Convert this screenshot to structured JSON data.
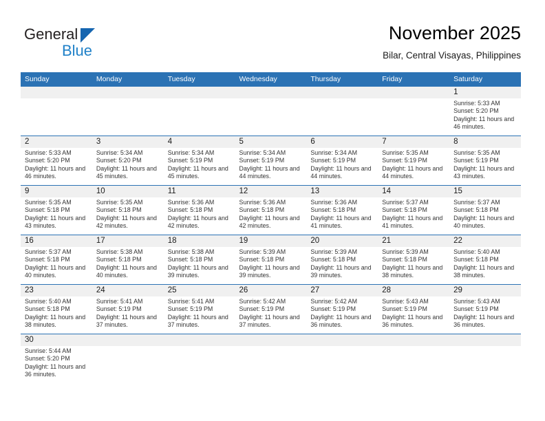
{
  "brand": {
    "name_part1": "General",
    "name_part2": "Blue",
    "colors": {
      "dark": "#231f20",
      "blue": "#2081c8",
      "triangle": "#1565b0"
    }
  },
  "header": {
    "title": "November 2025",
    "subtitle": "Bilar, Central Visayas, Philippines"
  },
  "theme": {
    "header_bg": "#2b72b4",
    "daynum_bg": "#f0f0f0",
    "row_divider": "#2b72b4"
  },
  "weekdays": [
    "Sunday",
    "Monday",
    "Tuesday",
    "Wednesday",
    "Thursday",
    "Friday",
    "Saturday"
  ],
  "labels": {
    "sunrise": "Sunrise:",
    "sunset": "Sunset:",
    "daylight": "Daylight:"
  },
  "weeks": [
    [
      {
        "empty": true
      },
      {
        "empty": true
      },
      {
        "empty": true
      },
      {
        "empty": true
      },
      {
        "empty": true
      },
      {
        "empty": true
      },
      {
        "day": "1",
        "sunrise": "Sunrise: 5:33 AM",
        "sunset": "Sunset: 5:20 PM",
        "daylight": "Daylight: 11 hours and 46 minutes."
      }
    ],
    [
      {
        "day": "2",
        "sunrise": "Sunrise: 5:33 AM",
        "sunset": "Sunset: 5:20 PM",
        "daylight": "Daylight: 11 hours and 46 minutes."
      },
      {
        "day": "3",
        "sunrise": "Sunrise: 5:34 AM",
        "sunset": "Sunset: 5:20 PM",
        "daylight": "Daylight: 11 hours and 45 minutes."
      },
      {
        "day": "4",
        "sunrise": "Sunrise: 5:34 AM",
        "sunset": "Sunset: 5:19 PM",
        "daylight": "Daylight: 11 hours and 45 minutes."
      },
      {
        "day": "5",
        "sunrise": "Sunrise: 5:34 AM",
        "sunset": "Sunset: 5:19 PM",
        "daylight": "Daylight: 11 hours and 44 minutes."
      },
      {
        "day": "6",
        "sunrise": "Sunrise: 5:34 AM",
        "sunset": "Sunset: 5:19 PM",
        "daylight": "Daylight: 11 hours and 44 minutes."
      },
      {
        "day": "7",
        "sunrise": "Sunrise: 5:35 AM",
        "sunset": "Sunset: 5:19 PM",
        "daylight": "Daylight: 11 hours and 44 minutes."
      },
      {
        "day": "8",
        "sunrise": "Sunrise: 5:35 AM",
        "sunset": "Sunset: 5:19 PM",
        "daylight": "Daylight: 11 hours and 43 minutes."
      }
    ],
    [
      {
        "day": "9",
        "sunrise": "Sunrise: 5:35 AM",
        "sunset": "Sunset: 5:18 PM",
        "daylight": "Daylight: 11 hours and 43 minutes."
      },
      {
        "day": "10",
        "sunrise": "Sunrise: 5:35 AM",
        "sunset": "Sunset: 5:18 PM",
        "daylight": "Daylight: 11 hours and 42 minutes."
      },
      {
        "day": "11",
        "sunrise": "Sunrise: 5:36 AM",
        "sunset": "Sunset: 5:18 PM",
        "daylight": "Daylight: 11 hours and 42 minutes."
      },
      {
        "day": "12",
        "sunrise": "Sunrise: 5:36 AM",
        "sunset": "Sunset: 5:18 PM",
        "daylight": "Daylight: 11 hours and 42 minutes."
      },
      {
        "day": "13",
        "sunrise": "Sunrise: 5:36 AM",
        "sunset": "Sunset: 5:18 PM",
        "daylight": "Daylight: 11 hours and 41 minutes."
      },
      {
        "day": "14",
        "sunrise": "Sunrise: 5:37 AM",
        "sunset": "Sunset: 5:18 PM",
        "daylight": "Daylight: 11 hours and 41 minutes."
      },
      {
        "day": "15",
        "sunrise": "Sunrise: 5:37 AM",
        "sunset": "Sunset: 5:18 PM",
        "daylight": "Daylight: 11 hours and 40 minutes."
      }
    ],
    [
      {
        "day": "16",
        "sunrise": "Sunrise: 5:37 AM",
        "sunset": "Sunset: 5:18 PM",
        "daylight": "Daylight: 11 hours and 40 minutes."
      },
      {
        "day": "17",
        "sunrise": "Sunrise: 5:38 AM",
        "sunset": "Sunset: 5:18 PM",
        "daylight": "Daylight: 11 hours and 40 minutes."
      },
      {
        "day": "18",
        "sunrise": "Sunrise: 5:38 AM",
        "sunset": "Sunset: 5:18 PM",
        "daylight": "Daylight: 11 hours and 39 minutes."
      },
      {
        "day": "19",
        "sunrise": "Sunrise: 5:39 AM",
        "sunset": "Sunset: 5:18 PM",
        "daylight": "Daylight: 11 hours and 39 minutes."
      },
      {
        "day": "20",
        "sunrise": "Sunrise: 5:39 AM",
        "sunset": "Sunset: 5:18 PM",
        "daylight": "Daylight: 11 hours and 39 minutes."
      },
      {
        "day": "21",
        "sunrise": "Sunrise: 5:39 AM",
        "sunset": "Sunset: 5:18 PM",
        "daylight": "Daylight: 11 hours and 38 minutes."
      },
      {
        "day": "22",
        "sunrise": "Sunrise: 5:40 AM",
        "sunset": "Sunset: 5:18 PM",
        "daylight": "Daylight: 11 hours and 38 minutes."
      }
    ],
    [
      {
        "day": "23",
        "sunrise": "Sunrise: 5:40 AM",
        "sunset": "Sunset: 5:18 PM",
        "daylight": "Daylight: 11 hours and 38 minutes."
      },
      {
        "day": "24",
        "sunrise": "Sunrise: 5:41 AM",
        "sunset": "Sunset: 5:19 PM",
        "daylight": "Daylight: 11 hours and 37 minutes."
      },
      {
        "day": "25",
        "sunrise": "Sunrise: 5:41 AM",
        "sunset": "Sunset: 5:19 PM",
        "daylight": "Daylight: 11 hours and 37 minutes."
      },
      {
        "day": "26",
        "sunrise": "Sunrise: 5:42 AM",
        "sunset": "Sunset: 5:19 PM",
        "daylight": "Daylight: 11 hours and 37 minutes."
      },
      {
        "day": "27",
        "sunrise": "Sunrise: 5:42 AM",
        "sunset": "Sunset: 5:19 PM",
        "daylight": "Daylight: 11 hours and 36 minutes."
      },
      {
        "day": "28",
        "sunrise": "Sunrise: 5:43 AM",
        "sunset": "Sunset: 5:19 PM",
        "daylight": "Daylight: 11 hours and 36 minutes."
      },
      {
        "day": "29",
        "sunrise": "Sunrise: 5:43 AM",
        "sunset": "Sunset: 5:19 PM",
        "daylight": "Daylight: 11 hours and 36 minutes."
      }
    ],
    [
      {
        "day": "30",
        "sunrise": "Sunrise: 5:44 AM",
        "sunset": "Sunset: 5:20 PM",
        "daylight": "Daylight: 11 hours and 36 minutes."
      },
      {
        "empty": true
      },
      {
        "empty": true
      },
      {
        "empty": true
      },
      {
        "empty": true
      },
      {
        "empty": true
      },
      {
        "empty": true
      }
    ]
  ]
}
